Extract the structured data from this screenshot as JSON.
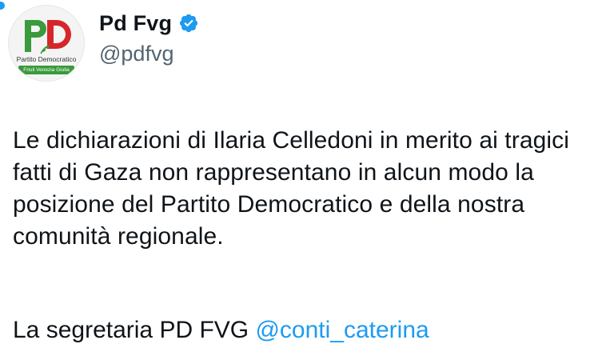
{
  "account": {
    "display_name": "Pd Fvg",
    "handle": "@pdfvg",
    "verified": true,
    "avatar_logo": {
      "letters": "PD",
      "line1": "Partito Democratico",
      "line2": "Friuli Venezia Giulia"
    }
  },
  "tweet": {
    "body": "Le dichiarazioni di Ilaria Celledoni in merito ai tragici fatti di Gaza non rappresentano in alcun modo la posizione del Partito Democratico e della nostra comunità regionale.",
    "signature_prefix": "La segretaria PD FVG ",
    "mention": "@conti_caterina"
  },
  "colors": {
    "mention": "#1d9bf0",
    "verified_badge": "#1d9bf0",
    "logo_green": "#3a9a3c",
    "logo_red": "#d6262b"
  }
}
